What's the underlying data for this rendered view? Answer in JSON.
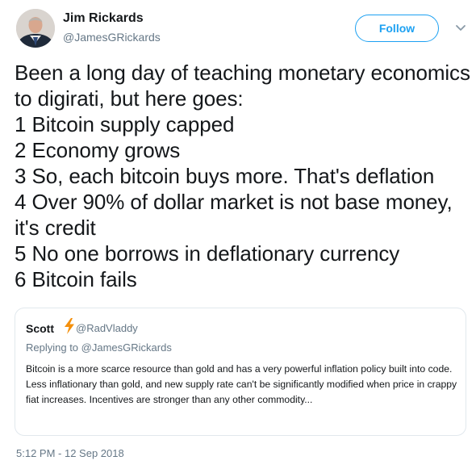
{
  "author": {
    "name": "Jim Rickards",
    "handle": "@JamesGRickards"
  },
  "header": {
    "follow_label": "Follow",
    "menu_icon": "chevron-down-icon"
  },
  "tweet": {
    "text": "Been a long day of teaching monetary economics to digirati, but here goes:\n1 Bitcoin supply capped\n2 Economy grows\n3 So, each bitcoin buys more. That's deflation\n4 Over 90% of dollar market is not base money, it's credit\n5 No one borrows in deflationary currency\n6 Bitcoin fails",
    "timestamp": "5:12 PM - 12 Sep 2018"
  },
  "quote": {
    "name": "Scott",
    "emoji_icon": "lightning-bolt-icon",
    "handle": "@RadVladdy",
    "replying_prefix": "Replying to",
    "replying_to": "@JamesGRickards",
    "text": "Bitcoin is a more scarce resource than gold and has a very powerful inflation policy built into code. Less inflationary than gold, and new  supply rate can't be significantly modified when price in crappy fiat increases. Incentives are stronger than any other commodity..."
  },
  "colors": {
    "accent": "#1da1f2",
    "text": "#14171a",
    "secondary": "#657786",
    "border": "#e1e8ed",
    "bolt": "#f4900c"
  }
}
